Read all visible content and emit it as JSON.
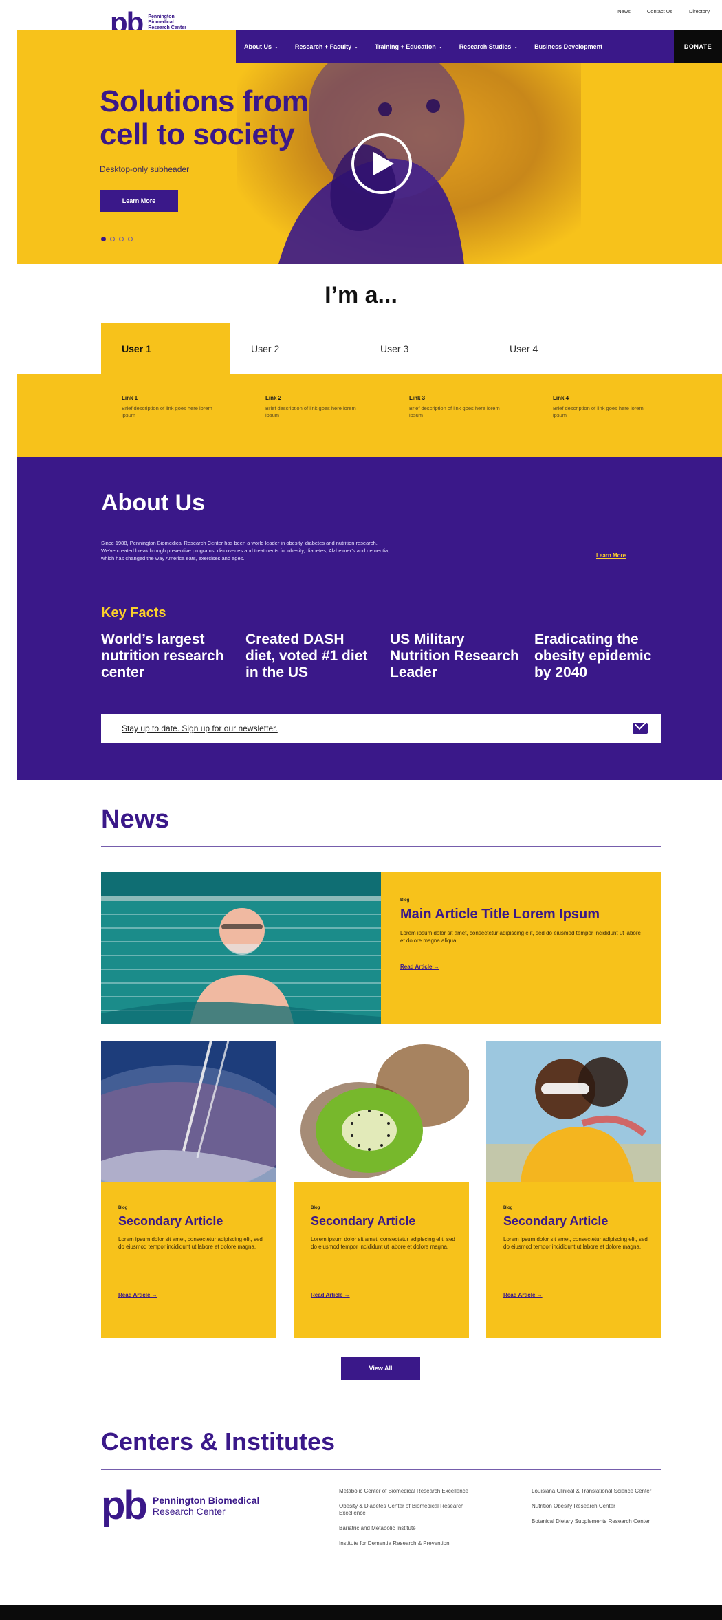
{
  "utility": {
    "news": "News",
    "contact": "Contact Us",
    "directory": "Directory"
  },
  "logo": {
    "text": "Pennington Biomedical Research Center"
  },
  "nav": {
    "items": [
      "About Us",
      "Research + Faculty",
      "Training + Education",
      "Research Studies",
      "Business Development"
    ],
    "donate": "DONATE"
  },
  "hero": {
    "headline": "Solutions from cell to society",
    "subheader": "Desktop-only subheader",
    "cta": "Learn More",
    "carousel_count": 4,
    "carousel_active": 1
  },
  "ima": {
    "title": "I’m a...",
    "tabs": [
      "User 1",
      "User 2",
      "User 3",
      "User 4"
    ],
    "links": [
      {
        "title": "Link 1",
        "desc": "Brief description of link goes here lorem ipsum"
      },
      {
        "title": "Link 2",
        "desc": "Brief description of link goes here lorem ipsum"
      },
      {
        "title": "Link 3",
        "desc": "Brief description of link goes here lorem ipsum"
      },
      {
        "title": "Link 4",
        "desc": "Brief description of link goes here lorem ipsum"
      }
    ]
  },
  "about": {
    "title": "About Us",
    "body": "Since 1988, Pennington Biomedical Research Center has been a world leader in obesity, diabetes and nutrition research. We’ve created breakthrough preventive programs, discoveries and treatments for obesity, diabetes, Alzheimer’s and dementia, which has changed the way America eats, exercises and ages.",
    "learn": "Learn More",
    "key_facts_title": "Key Facts",
    "facts": [
      "World’s largest nutrition research center",
      "Created DASH diet, voted #1 diet in the US",
      "US Military Nutrition Research Leader",
      "Eradicating the obesity epidemic by 2040"
    ],
    "newsletter": "Stay up to date. Sign up for our newsletter."
  },
  "news": {
    "title": "News",
    "main": {
      "eyebrow": "Blog",
      "title": "Main Article Title Lorem Ipsum",
      "body": "Lorem ipsum dolor sit amet, consectetur adipiscing elit, sed do eiusmod tempor incididunt ut labore et dolore magna aliqua.",
      "read": "Read Article →"
    },
    "cards": [
      {
        "eyebrow": "Blog",
        "title": "Secondary Article",
        "body": "Lorem ipsum dolor sit amet, consectetur adipiscing elit, sed do eiusmod tempor incididunt ut labore et dolore magna.",
        "read": "Read Article →"
      },
      {
        "eyebrow": "Blog",
        "title": "Secondary Article",
        "body": "Lorem ipsum dolor sit amet, consectetur adipiscing elit, sed do eiusmod tempor incididunt ut labore et dolore magna.",
        "read": "Read Article →"
      },
      {
        "eyebrow": "Blog",
        "title": "Secondary Article",
        "body": "Lorem ipsum dolor sit amet, consectetur adipiscing elit, sed do eiusmod tempor incididunt ut labore et dolore magna.",
        "read": "Read Article →"
      }
    ],
    "view_all": "View All"
  },
  "centers": {
    "title": "Centers & Institutes",
    "logo_name": "Pennington Biomedical",
    "logo_sub": "Research Center",
    "col1": [
      "Metabolic Center of Biomedical Research Excellence",
      "Obesity & Diabetes Center of Biomedical Research Excellence",
      "Bariatric and Metabolic Institute",
      "Institute for Dementia Research & Prevention"
    ],
    "col2": [
      "Louisiana Clinical & Translational Science Center",
      "Nutrition Obesity Research Center",
      "Botanical Dietary Supplements Research Center"
    ]
  },
  "colors": {
    "purple": "#3a1889",
    "gold": "#f7c21b",
    "black": "#0b0b0b"
  }
}
